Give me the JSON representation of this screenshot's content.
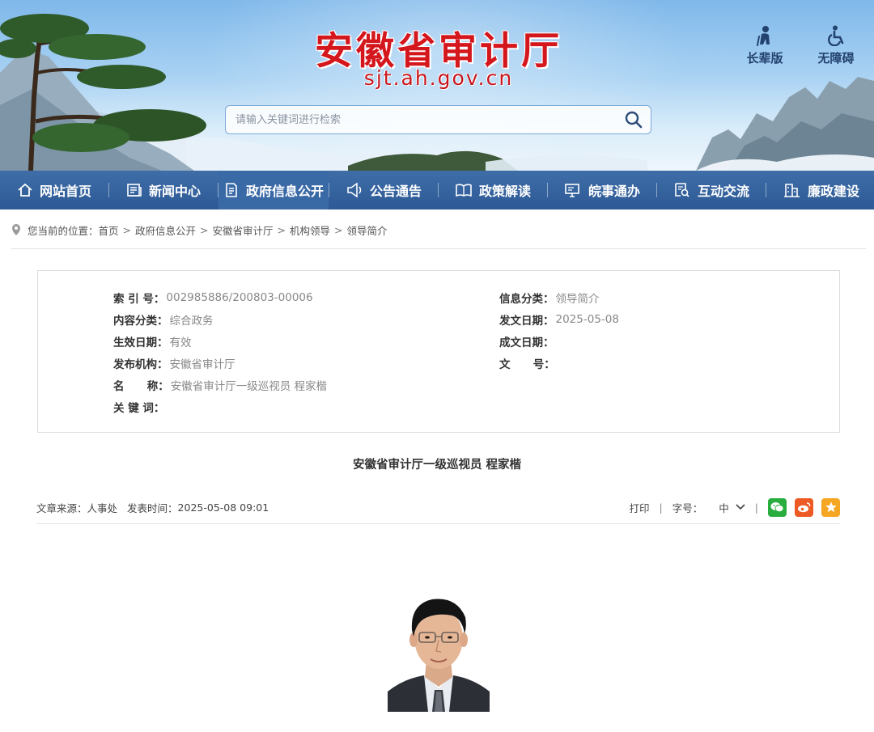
{
  "header": {
    "title": "安徽省审计厅",
    "domain": "sjt.ah.gov.cn",
    "search_placeholder": "请输入关键词进行检索",
    "tools": [
      {
        "label": "长辈版",
        "icon": "elder-icon"
      },
      {
        "label": "无障碍",
        "icon": "wheelchair-icon"
      }
    ]
  },
  "nav": {
    "items": [
      {
        "label": "网站首页",
        "icon": "home-icon"
      },
      {
        "label": "新闻中心",
        "icon": "newspaper-icon"
      },
      {
        "label": "政府信息公开",
        "icon": "document-icon",
        "active": true
      },
      {
        "label": "公告通告",
        "icon": "megaphone-icon"
      },
      {
        "label": "政策解读",
        "icon": "book-icon"
      },
      {
        "label": "皖事通办",
        "icon": "monitor-icon"
      },
      {
        "label": "互动交流",
        "icon": "chat-search-icon"
      },
      {
        "label": "廉政建设",
        "icon": "building-icon"
      }
    ]
  },
  "breadcrumb": {
    "prefix": "您当前的位置：",
    "items": [
      "首页",
      "政府信息公开",
      "安徽省审计厅",
      "机构领导",
      "领导简介"
    ],
    "separator": ">"
  },
  "meta": {
    "left": [
      {
        "key": "索 引 号：",
        "value": "002985886/200803-00006"
      },
      {
        "key": "内容分类：",
        "value": "综合政务"
      },
      {
        "key": "生效日期：",
        "value": "有效"
      },
      {
        "key": "发布机构：",
        "value": "安徽省审计厅"
      },
      {
        "key": "名      称：",
        "value": "安徽省审计厅一级巡视员 程家楷"
      },
      {
        "key": "关 键 词：",
        "value": ""
      }
    ],
    "right": [
      {
        "key": "信息分类：",
        "value": "领导简介"
      },
      {
        "key": "发文日期：",
        "value": "2025-05-08"
      },
      {
        "key": "成文日期：",
        "value": ""
      },
      {
        "key": "文      号：",
        "value": ""
      }
    ]
  },
  "article": {
    "title": "安徽省审计厅一级巡视员 程家楷",
    "source_label": "文章来源：",
    "source": "人事处",
    "time_label": "发表时间：",
    "time": "2025-05-08 09:01",
    "print_label": "打印",
    "font_size_label": "字号：",
    "font_size_value": "中",
    "share": [
      "wechat-icon",
      "weibo-icon",
      "favorite-icon"
    ]
  },
  "colors": {
    "title_red": "#d4161d",
    "nav_blue": "#2d5a96",
    "tool_text": "#23426e"
  }
}
